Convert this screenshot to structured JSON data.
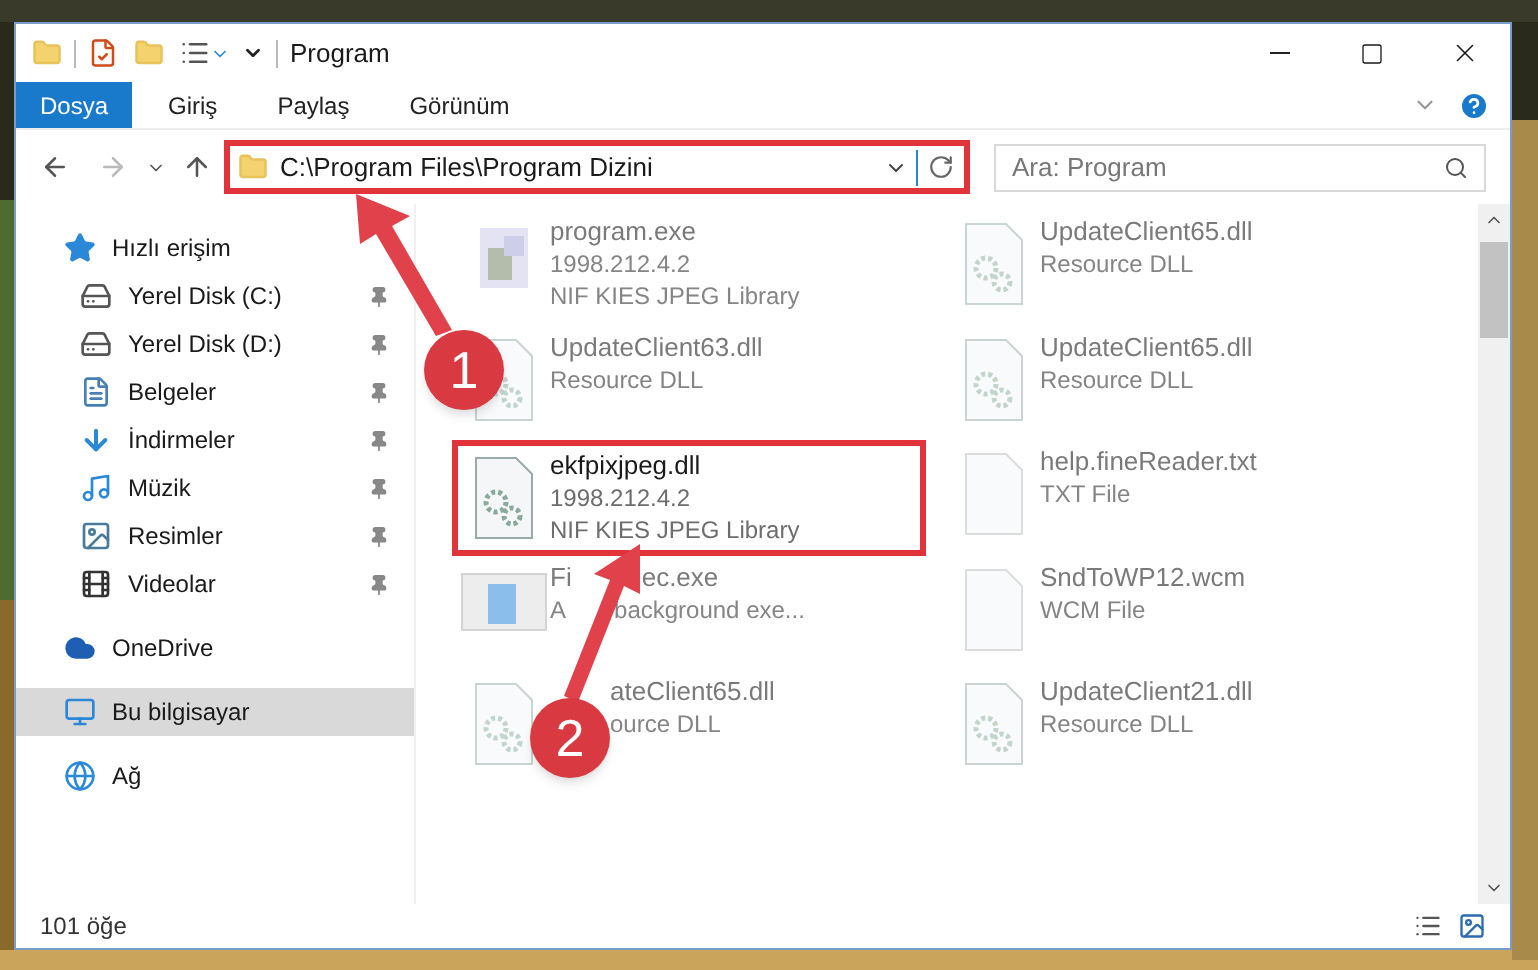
{
  "window": {
    "title": "Program"
  },
  "ribbon_tabs": [
    {
      "label": "Dosya",
      "selected": true
    },
    {
      "label": "Giriş",
      "selected": false
    },
    {
      "label": "Paylaş",
      "selected": false
    },
    {
      "label": "Görünüm",
      "selected": false
    }
  ],
  "address_bar": {
    "path": "C:\\Program Files\\Program Dizini",
    "highlighted": true
  },
  "search": {
    "placeholder": "Ara: Program"
  },
  "sidebar": {
    "items": [
      {
        "label": "Hızlı erişim",
        "selected": false,
        "children": [
          {
            "label": "Yerel Disk (C:)",
            "pinned": true,
            "selected": false
          },
          {
            "label": "Yerel Disk (D:)",
            "pinned": true,
            "selected": false
          },
          {
            "label": "Belgeler",
            "pinned": true,
            "selected": false
          },
          {
            "label": "İndirmeler",
            "pinned": true,
            "selected": false
          },
          {
            "label": "Müzik",
            "pinned": true,
            "selected": false
          },
          {
            "label": "Resimler",
            "pinned": true,
            "selected": false
          },
          {
            "label": "Videolar",
            "pinned": true,
            "selected": false
          }
        ]
      },
      {
        "label": "OneDrive",
        "selected": false
      },
      {
        "label": "Bu bilgisayar",
        "selected": true
      },
      {
        "label": "Ağ",
        "selected": false
      }
    ]
  },
  "files": [
    {
      "kind": "exe",
      "name_parts": [
        "program.exe"
      ],
      "details": [
        "1998.212.4.2",
        "NIF KIES JPEG Library"
      ],
      "blurred": true,
      "highlighted": false,
      "covered_start": false
    },
    {
      "kind": "dll",
      "name_parts": [
        "UpdateClient65.dll"
      ],
      "details": [
        "Resource DLL"
      ],
      "blurred": true,
      "highlighted": false,
      "covered_start": false
    },
    {
      "kind": "dll",
      "name_parts": [
        "UpdateClient63.dll"
      ],
      "details": [
        "Resource DLL"
      ],
      "blurred": true,
      "highlighted": false,
      "covered_start": false
    },
    {
      "kind": "dll",
      "name_parts": [
        "UpdateClient65.dll"
      ],
      "details": [
        "Resource DLL"
      ],
      "blurred": true,
      "highlighted": false,
      "covered_start": false
    },
    {
      "kind": "dll",
      "name_parts": [
        "ekfpixjpeg.dll"
      ],
      "details": [
        "1998.212.4.2",
        "NIF KIES JPEG Library"
      ],
      "blurred": false,
      "highlighted": true,
      "covered_start": false
    },
    {
      "kind": "txt",
      "name_parts": [
        "help.fineReader.txt"
      ],
      "details": [
        "TXT File"
      ],
      "blurred": true,
      "highlighted": false,
      "covered_start": false
    },
    {
      "kind": "app",
      "name_parts": [
        "Fi",
        "ec.exe"
      ],
      "details": [
        "A",
        "background exe..."
      ],
      "blurred": true,
      "highlighted": false,
      "covered_start": false
    },
    {
      "kind": "txt",
      "name_parts": [
        "SndToWP12.wcm"
      ],
      "details": [
        "WCM File"
      ],
      "blurred": true,
      "highlighted": false,
      "covered_start": false
    },
    {
      "kind": "dll",
      "name_parts": [
        "ateClient65.dll"
      ],
      "details": [
        "ource DLL"
      ],
      "blurred": true,
      "highlighted": false,
      "covered_start": true
    },
    {
      "kind": "dll",
      "name_parts": [
        "UpdateClient21.dll"
      ],
      "details": [
        "Resource DLL"
      ],
      "blurred": true,
      "highlighted": false,
      "covered_start": false
    }
  ],
  "status_bar": {
    "item_count": "101 öğe"
  },
  "annotations": [
    {
      "number": "1"
    },
    {
      "number": "2"
    }
  ]
}
